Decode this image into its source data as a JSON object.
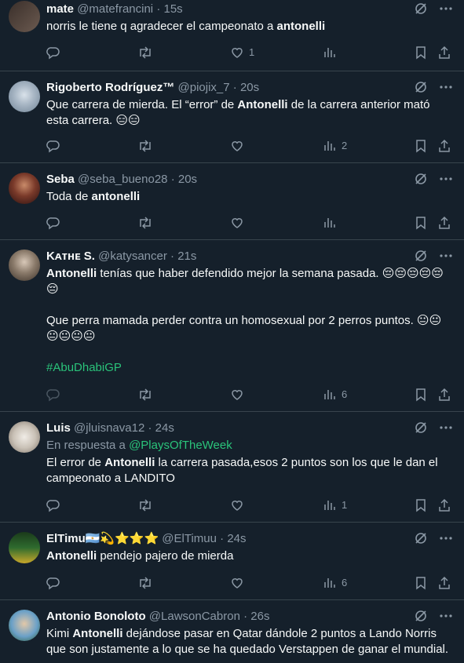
{
  "colors": {
    "background": "#15202b",
    "divider": "#38444d",
    "muted": "#8b98a5",
    "link": "#2ac37a"
  },
  "tweets": [
    {
      "name": "mate",
      "handle": "@matefrancini",
      "time": "15s",
      "text_before": "norris le tiene q agradecer el campeonato a ",
      "bold": "antonelli",
      "text_after": "",
      "likes": "1",
      "views": "",
      "retweets": "",
      "replies": ""
    },
    {
      "name": "Rigoberto Rodríguez™",
      "handle": "@piojix_7",
      "time": "20s",
      "text_before": "Que carrera de mierda. El “error” de ",
      "bold": "Antonelli",
      "text_after": " de la carrera anterior mató esta carrera. 😑😑",
      "likes": "",
      "views": "2",
      "retweets": "",
      "replies": ""
    },
    {
      "name": "Seba",
      "handle": "@seba_bueno28",
      "time": "20s",
      "text_before": "Toda de ",
      "bold": "antonelli",
      "text_after": "",
      "likes": "",
      "views": "",
      "retweets": "",
      "replies": ""
    },
    {
      "name": "Kᴀᴛʜᴇ S.",
      "handle": "@katysancer",
      "time": "21s",
      "bold": "Antonelli",
      "text_after": " tenías que haber defendido mejor la semana pasada. 😔😔😔😔😔😔",
      "line2": "Que perra mamada perder contra un homosexual por 2 perros puntos. 😐😐😐😐😐😐",
      "hashtag": "#AbuDhabiGP",
      "likes": "",
      "views": "6",
      "retweets": "",
      "replies": ""
    },
    {
      "name": "Luis",
      "handle": "@jluisnava12",
      "time": "24s",
      "reply_label": "En respuesta a",
      "reply_mention": "@PlaysOfTheWeek",
      "text_before": "El error de ",
      "bold": "Antonelli",
      "text_after": " la carrera pasada,esos 2 puntos son los que le dan el campeonato a LANDITO",
      "likes": "",
      "views": "1",
      "retweets": "",
      "replies": ""
    },
    {
      "name": "ElTimu🇦🇷💫⭐⭐⭐",
      "handle": "@ElTimuu",
      "time": "24s",
      "text_before": "",
      "bold": "Antonelli",
      "text_after": " pendejo pajero de mierda",
      "likes": "",
      "views": "6",
      "retweets": "",
      "replies": ""
    },
    {
      "name": "Antonio Bonoloto",
      "handle": "@LawsonCabron",
      "time": "26s",
      "text_before": "Kimi ",
      "bold": "Antonelli",
      "text_after": " dejándose pasar en Qatar dándole 2 puntos a Lando Norris que son justamente a lo que se ha quedado Verstappen de ganar el mundial.",
      "likes": "",
      "views": "",
      "retweets": "",
      "replies": ""
    }
  ],
  "sep": "·"
}
